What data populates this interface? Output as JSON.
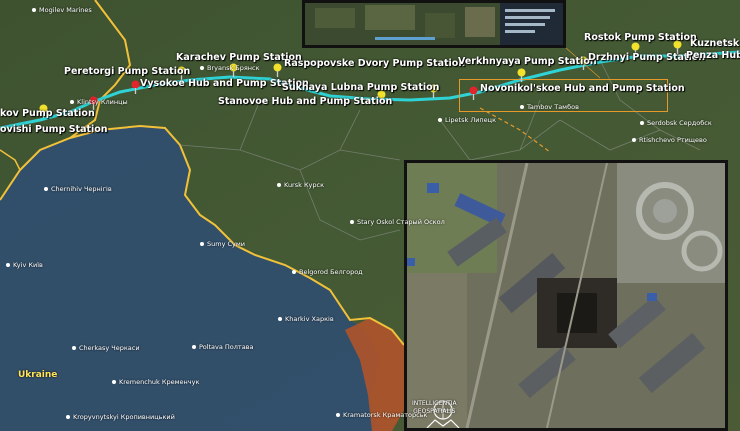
{
  "map": {
    "country_label": "Ukraine",
    "colors": {
      "pipeline": "#2fd3d6",
      "border": "#f2c13a",
      "ukraine_tint": "#2f4e74",
      "region_red": "#b0532a",
      "callout": "#e79a2a"
    }
  },
  "stations": [
    {
      "id": "peretorgi",
      "label": "Peretorgi Pump Station"
    },
    {
      "id": "karachev",
      "label": "Karachev Pump Station"
    },
    {
      "id": "vysokoe",
      "label": "Vysokoe Hub and Pump Station"
    },
    {
      "id": "raspopovske",
      "label": "Raspopovske Dvory Pump Station"
    },
    {
      "id": "sukhaya",
      "label": "Sukhaya Lubna Pump Station"
    },
    {
      "id": "stanovoe",
      "label": "Stanovoe Hub and Pump Station"
    },
    {
      "id": "verkhnyaya",
      "label": "Verkhnyaya Pump Station"
    },
    {
      "id": "drzhnyi",
      "label": "Drzhnyi Pump Station"
    },
    {
      "id": "rostok",
      "label": "Rostok Pump Station"
    },
    {
      "id": "kuznetsk",
      "label": "Kuznetsk P"
    },
    {
      "id": "penza",
      "label": "Penza Hub a"
    },
    {
      "id": "novonikolskoe",
      "label": "Novonikol'skoe Hub and Pump Station"
    },
    {
      "id": "kov",
      "label": "kov Pump Station"
    },
    {
      "id": "ovishi",
      "label": "ovishi Pump Station"
    }
  ],
  "cities": [
    {
      "id": "mogilev",
      "label": "Mogilev Marines"
    },
    {
      "id": "bryansk",
      "label": "Bryansk Брянск"
    },
    {
      "id": "klintsy",
      "label": "Klintsy Клинцы"
    },
    {
      "id": "lipetsk",
      "label": "Lipetsk Липецк"
    },
    {
      "id": "tambov",
      "label": "Tambov Тамбов"
    },
    {
      "id": "serdobsk",
      "label": "Serdobsk Сердобск"
    },
    {
      "id": "rtishchevo",
      "label": "Rtishchevo Ртищево"
    },
    {
      "id": "kursk",
      "label": "Kursk Курск"
    },
    {
      "id": "staryoskol",
      "label": "Stary Oskol Старый Оскол"
    },
    {
      "id": "chernihiv",
      "label": "Chernihiv Чернігів"
    },
    {
      "id": "sumy",
      "label": "Sumy Суми"
    },
    {
      "id": "belgorod",
      "label": "Belgorod Белгород"
    },
    {
      "id": "kyiv",
      "label": "Kyiv Київ"
    },
    {
      "id": "kharkiv",
      "label": "Kharkiv Харків"
    },
    {
      "id": "cherkasy",
      "label": "Cherkasy Черкаси"
    },
    {
      "id": "poltava",
      "label": "Poltava Полтава"
    },
    {
      "id": "kremenchuk",
      "label": "Kremenchuk Кременчук"
    },
    {
      "id": "kropyvnytskyi",
      "label": "Kropyvnytskyi Кропивницький"
    },
    {
      "id": "kramatorsk",
      "label": "Kramatorsk Краматорськ"
    }
  ],
  "inset": {
    "logo_line1": "INTELLIGENTIA",
    "logo_line2": "GEOSPATIALIS"
  }
}
